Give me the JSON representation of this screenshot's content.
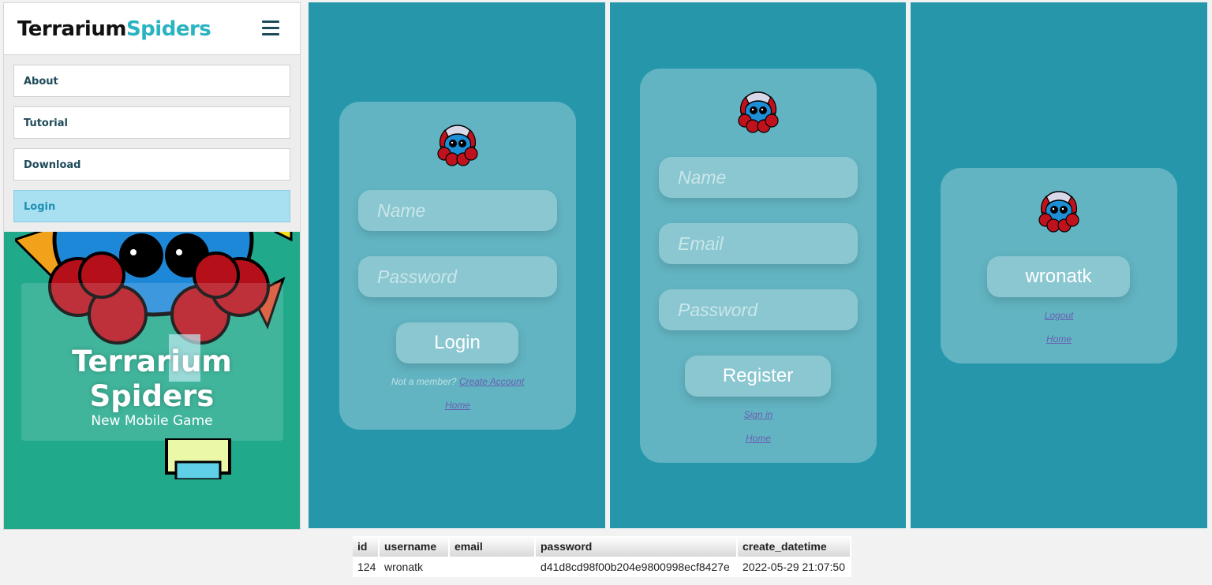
{
  "brand": {
    "part1": "Terrarium",
    "part2": "Spiders"
  },
  "menu": {
    "items": [
      {
        "label": "About"
      },
      {
        "label": "Tutorial"
      },
      {
        "label": "Download"
      },
      {
        "label": "Login"
      }
    ]
  },
  "hero": {
    "title_line1": "Terrarium",
    "title_line2": "Spiders",
    "subtitle": "New Mobile Game"
  },
  "login": {
    "name_placeholder": "Name",
    "password_placeholder": "Password",
    "button": "Login",
    "not_member": "Not a member?",
    "create_account": "Create Account",
    "home": "Home"
  },
  "register": {
    "name_placeholder": "Name",
    "email_placeholder": "Email",
    "password_placeholder": "Password",
    "button": "Register",
    "sign_in": "Sign in",
    "home": "Home"
  },
  "profile": {
    "username": "wronatk",
    "logout": "Logout",
    "home": "Home"
  },
  "db_table": {
    "headers": [
      "id",
      "username",
      "email",
      "password",
      "create_datetime"
    ],
    "rows": [
      [
        "124",
        "wronatk",
        "",
        "d41d8cd98f00b204e9800998ecf8427e",
        "2022-05-29 21:07:50"
      ]
    ]
  },
  "colors": {
    "teal": "#2697ab",
    "hero_green": "#21a98b",
    "brand_accent": "#2ab3c0",
    "active_item": "#a8dff1"
  }
}
